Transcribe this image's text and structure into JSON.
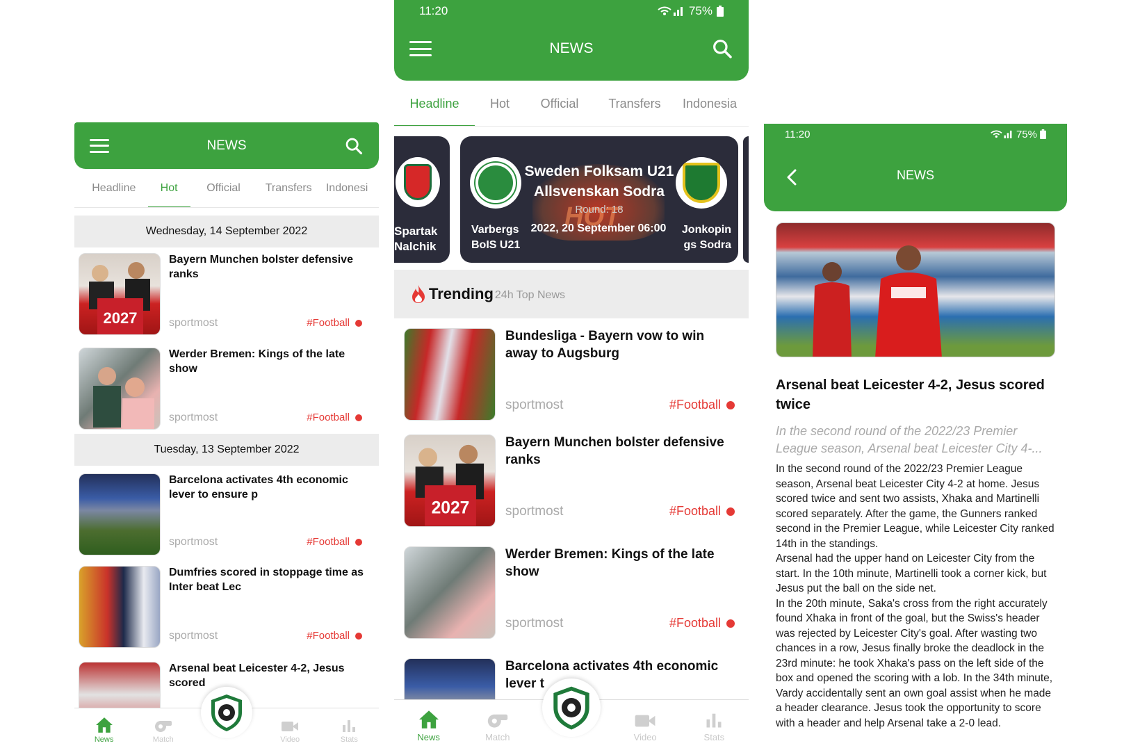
{
  "left": {
    "appbar": {
      "title": "NEWS"
    },
    "tabs": [
      "Headline",
      "Hot",
      "Official",
      "Transfers",
      "Indonesi"
    ],
    "active_tab": 1,
    "groups": [
      {
        "date": "Wednesday, 14 September 2022",
        "items": [
          {
            "title": "Bayern Munchen bolster defensive ranks",
            "source": "sportmost",
            "tag": "#Football"
          },
          {
            "title": "Werder Bremen: Kings of the late show",
            "source": "sportmost",
            "tag": "#Football"
          }
        ]
      },
      {
        "date": "Tuesday, 13 September 2022",
        "items": [
          {
            "title": "Barcelona activates 4th economic lever to ensure p",
            "source": "sportmost",
            "tag": "#Football"
          },
          {
            "title": "Dumfries scored in stoppage time as Inter beat Lec",
            "source": "sportmost",
            "tag": "#Football"
          },
          {
            "title": "Arsenal beat Leicester 4-2, Jesus scored",
            "source": "",
            "tag": ""
          }
        ]
      }
    ],
    "nav": [
      "News",
      "Match",
      "Video",
      "Stats"
    ]
  },
  "middle": {
    "status": {
      "time": "11:20",
      "battery": "75%"
    },
    "appbar": {
      "title": "NEWS"
    },
    "tabs": [
      "Headline",
      "Hot",
      "Official",
      "Transfers",
      "Indonesia"
    ],
    "active_tab": 0,
    "match_prev": {
      "team": "Spartak Nalchik"
    },
    "match": {
      "league": "Sweden Folksam U21 Allsvenskan Sodra",
      "round": "Round: 18",
      "home": "Varbergs BoIS U21",
      "away": "Jonkoping Sodra",
      "away_shown": "Jonkopin gs Sodra",
      "datetime": "2022, 20 September 06:00",
      "badge": "HOT"
    },
    "trending": {
      "title": "Trending",
      "subtitle": "24h Top News"
    },
    "items": [
      {
        "title": "Bundesliga - Bayern vow to win away to Augsburg",
        "source": "sportmost",
        "tag": "#Football"
      },
      {
        "title": "Bayern Munchen bolster defensive ranks",
        "source": "sportmost",
        "tag": "#Football"
      },
      {
        "title": "Werder Bremen: Kings of the late show",
        "source": "sportmost",
        "tag": "#Football"
      },
      {
        "title": "Barcelona activates 4th economic lever t",
        "source": "",
        "tag": ""
      }
    ],
    "nav": [
      "News",
      "Match",
      "Video",
      "Stats"
    ]
  },
  "right": {
    "status": {
      "time": "11:20",
      "battery": "75%"
    },
    "appbar": {
      "title": "NEWS"
    },
    "article": {
      "title": "Arsenal beat Leicester 4-2, Jesus scored twice",
      "summary": "In the second round of the 2022/23 Premier League season, Arsenal beat Leicester City 4-...",
      "body": [
        "In the second round of the 2022/23 Premier League season, Arsenal beat Leicester City 4-2 at home. Jesus scored twice and sent two assists, Xhaka and Martinelli scored separately. After the game, the Gunners ranked second in the Premier League, while Leicester City ranked 14th in the standings.",
        "Arsenal had the upper hand on Leicester City from the start. In the 10th minute, Martinelli took a corner kick, but Jesus put the ball on the side net.",
        "In the 20th minute, Saka's cross from the right accurately found Xhaka in front of the goal, but the Swiss's header was rejected by Leicester City's goal. After wasting two chances in a row, Jesus finally broke the deadlock in the 23rd minute: he took Xhaka's pass on the left side of the box and opened the scoring with a lob. In the 34th minute, Vardy accidentally sent an own goal assist when he made a header clearance. Jesus took the opportunity to score with a header and help Arsenal take a 2-0 lead."
      ]
    }
  },
  "colors": {
    "brand": "#3da23f",
    "tag": "#e53935",
    "card": "#2b2c3a"
  }
}
